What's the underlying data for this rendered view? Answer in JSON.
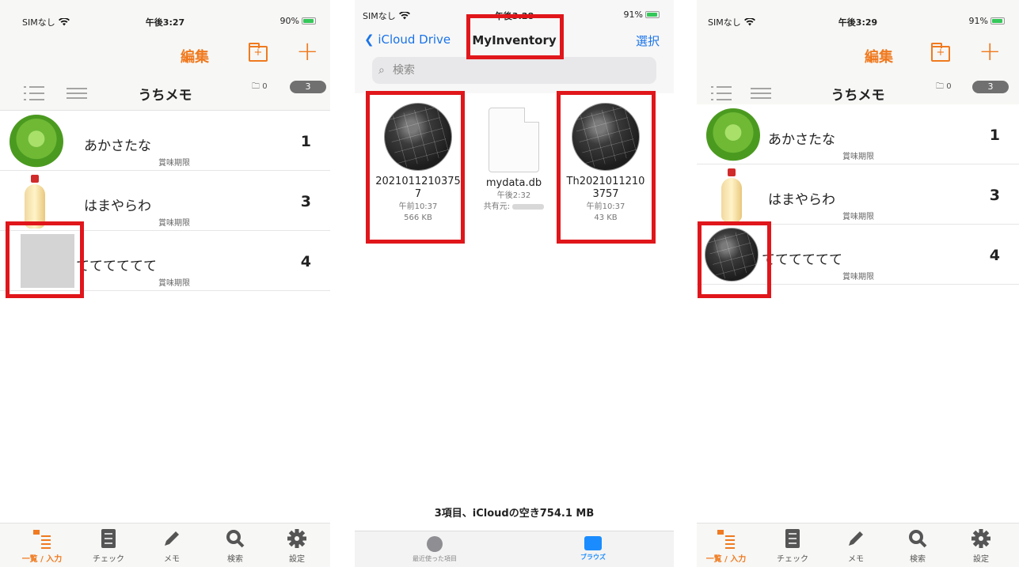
{
  "panel1": {
    "status": {
      "carrier": "SIMなし",
      "time": "午後3:27",
      "battery": "90%"
    },
    "nav": {
      "edit_label": "編集",
      "folder_add_glyph": "+",
      "plus_glyph": "+"
    },
    "subbar": {
      "title": "うちメモ",
      "folder_count": "0",
      "item_count": "3"
    },
    "items": [
      {
        "name": "あかさたな",
        "sub": "賞味期限",
        "count": "1",
        "thumb": "cabbage"
      },
      {
        "name": "はまやらわ",
        "sub": "賞味期限",
        "count": "3",
        "thumb": "mayonnaise"
      },
      {
        "name": "てててててて",
        "sub": "賞味期限",
        "count": "4",
        "thumb": "placeholder"
      }
    ],
    "tabs": [
      {
        "label": "一覧 / 入力",
        "icon": "list-icon",
        "active": true
      },
      {
        "label": "チェック",
        "icon": "checklist-icon"
      },
      {
        "label": "メモ",
        "icon": "pencil-icon"
      },
      {
        "label": "検索",
        "icon": "search-icon"
      },
      {
        "label": "設定",
        "icon": "gear-icon"
      }
    ]
  },
  "panel2": {
    "status": {
      "carrier": "SIMなし",
      "time": "午後3:28",
      "battery": "91%"
    },
    "nav": {
      "back_label": "iCloud Drive",
      "title": "MyInventory",
      "select_label": "選択"
    },
    "search": {
      "placeholder": "検索"
    },
    "files": [
      {
        "name_line1": "2021011210375",
        "name_line2": "7",
        "time": "午前10:37",
        "size": "566 KB"
      },
      {
        "name_line1": "mydata.db",
        "name_line2": "",
        "time": "午後2:32",
        "shared": "共有元:"
      },
      {
        "name_line1": "Th2021011210",
        "name_line2": "3757",
        "time": "午前10:37",
        "size": "43 KB"
      }
    ],
    "summary": "3項目、iCloudの空き754.1 MB",
    "tabs": [
      {
        "label": "最近使った項目",
        "icon": "clock-icon"
      },
      {
        "label": "ブラウズ",
        "icon": "folder-icon",
        "active": true
      }
    ]
  },
  "panel3": {
    "status": {
      "carrier": "SIMなし",
      "time": "午後3:29",
      "battery": "91%"
    },
    "nav": {
      "edit_label": "編集",
      "folder_add_glyph": "+",
      "plus_glyph": "+"
    },
    "subbar": {
      "title": "うちメモ",
      "folder_count": "0",
      "item_count": "3"
    },
    "items": [
      {
        "name": "あかさたな",
        "sub": "賞味期限",
        "count": "1",
        "thumb": "cabbage"
      },
      {
        "name": "はまやらわ",
        "sub": "賞味期限",
        "count": "3",
        "thumb": "mayonnaise"
      },
      {
        "name": "てててててて",
        "sub": "賞味期限",
        "count": "4",
        "thumb": "keyboard-photo"
      }
    ],
    "tabs": [
      {
        "label": "一覧 / 入力",
        "icon": "list-icon",
        "active": true
      },
      {
        "label": "チェック",
        "icon": "checklist-icon"
      },
      {
        "label": "メモ",
        "icon": "pencil-icon"
      },
      {
        "label": "検索",
        "icon": "search-icon"
      },
      {
        "label": "設定",
        "icon": "gear-icon"
      }
    ]
  },
  "colors": {
    "accent": "#f07a1f",
    "ios_blue": "#1a73e8",
    "annotation_red": "#e0161b"
  }
}
